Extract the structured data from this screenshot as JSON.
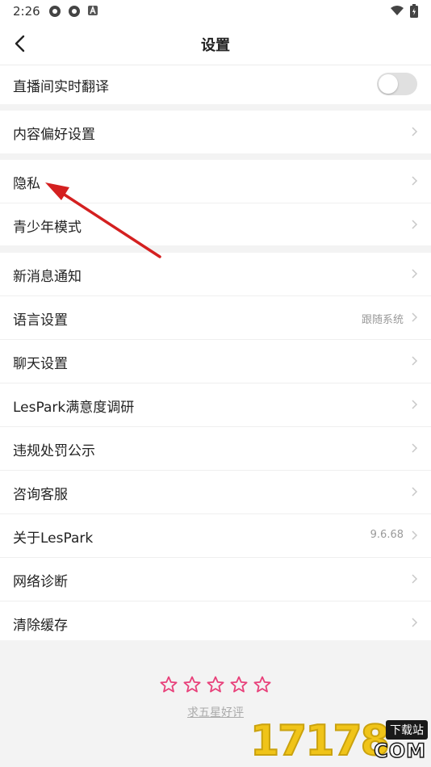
{
  "status_bar": {
    "time": "2:26"
  },
  "header": {
    "title": "设置"
  },
  "groups": {
    "g1": {
      "live_translate": "直播间实时翻译",
      "live_translate_on": false
    },
    "g2": {
      "content_pref": "内容偏好设置"
    },
    "g3": {
      "privacy": "隐私",
      "teen_mode": "青少年模式"
    },
    "g4": {
      "notifications": "新消息通知",
      "language": "语言设置",
      "language_value": "跟随系统",
      "chat": "聊天设置",
      "survey": "LesPark满意度调研",
      "violations": "违规处罚公示",
      "support": "咨询客服",
      "about": "关于LesPark",
      "about_value": "9.6.68",
      "network": "网络诊断",
      "cache": "清除缓存"
    }
  },
  "rating": {
    "stars": 5,
    "link_text": "求五星好评",
    "star_color": "#e8407a"
  },
  "watermark": {
    "digits": "17178",
    "tag": "下载站",
    "domain": "COM"
  },
  "annotation": {
    "arrow_color": "#d42020"
  }
}
